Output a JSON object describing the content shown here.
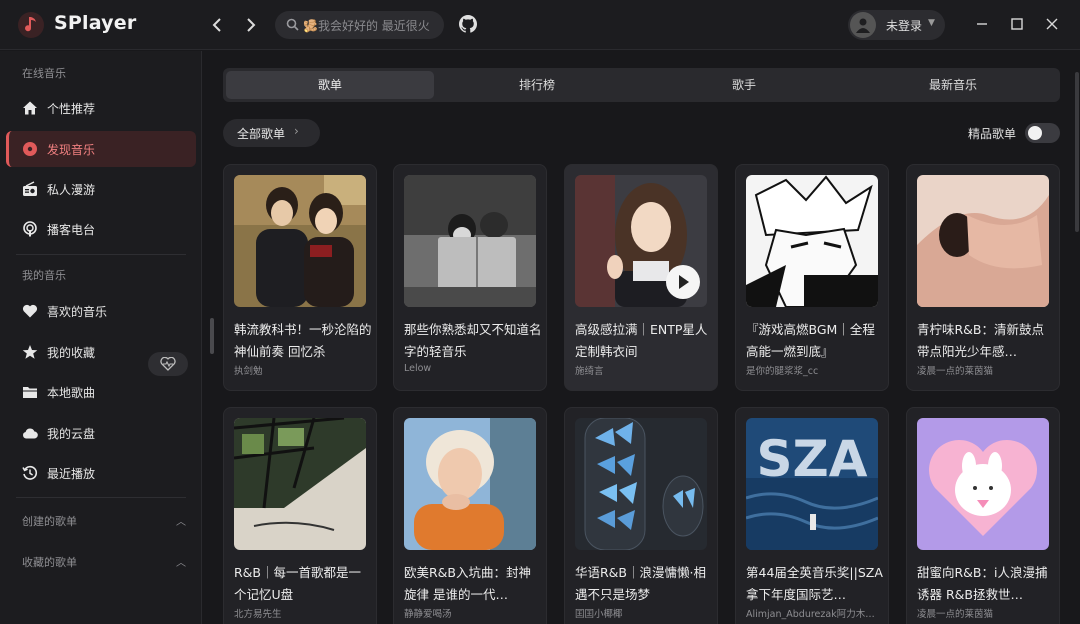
{
  "app": {
    "title": "SPlayer",
    "accent": "#e05a5a"
  },
  "search": {
    "placeholder": "🫚我会好好的 最近很火"
  },
  "user": {
    "name": "未登录"
  },
  "sidebar": {
    "section_online": "在线音乐",
    "section_mine": "我的音乐",
    "items_online": [
      {
        "label": "个性推荐",
        "icon": "home-icon"
      },
      {
        "label": "发现音乐",
        "icon": "disc-icon",
        "active": true
      },
      {
        "label": "私人漫游",
        "icon": "radio-icon"
      },
      {
        "label": "播客电台",
        "icon": "podcast-icon"
      }
    ],
    "items_mine": [
      {
        "label": "喜欢的音乐",
        "icon": "heart-icon"
      },
      {
        "label": "我的收藏",
        "icon": "star-icon"
      },
      {
        "label": "本地歌曲",
        "icon": "folder-icon"
      },
      {
        "label": "我的云盘",
        "icon": "cloud-icon"
      },
      {
        "label": "最近播放",
        "icon": "history-icon"
      }
    ],
    "created_playlists": "创建的歌单",
    "collected_playlists": "收藏的歌单"
  },
  "tabs": [
    {
      "label": "歌单",
      "active": true
    },
    {
      "label": "排行榜"
    },
    {
      "label": "歌手"
    },
    {
      "label": "最新音乐"
    }
  ],
  "filter": {
    "label": "全部歌单"
  },
  "quality": {
    "label": "精品歌单",
    "enabled": false
  },
  "playlists": [
    {
      "title": "韩流教科书！一秒沦陷的神仙前奏 回忆杀",
      "author": "执剑勉",
      "cover": "warm"
    },
    {
      "title": "那些你熟悉却又不知道名字的轻音乐",
      "author": "Lelow",
      "cover": "gray"
    },
    {
      "title": "高级感拉满｜ENTP星人定制韩衣间",
      "author": "施绮言",
      "cover": "portrait"
    },
    {
      "title": "『游戏高燃BGM｜全程高能一燃到底』",
      "author": "是你的腿浆浆_cc",
      "cover": "sketch"
    },
    {
      "title": "青柠味R&B：清新鼓点 带点阳光少年感…",
      "author": "凌晨一点的莱茵猫",
      "cover": "skin"
    },
    {
      "title": "R&B｜每一首歌都是一个记忆U盘",
      "author": "北方易先生",
      "cover": "window"
    },
    {
      "title": "欧美R&B入坑曲：封神旋律 是谁的一代…",
      "author": "静静爱喝汤",
      "cover": "blonde"
    },
    {
      "title": "华语R&B｜浪漫慵懒·相遇不只是场梦",
      "author": "囯囯小椰椰",
      "cover": "butterfly"
    },
    {
      "title": "第44届全英音乐奖||SZA拿下年度国际艺…",
      "author": "Alimjan_Abdurezak阿力木…",
      "cover": "ocean"
    },
    {
      "title": "甜蜜向R&B：i人浪漫捕诱器 R&B拯救世…",
      "author": "凌晨一点的莱茵猫",
      "cover": "pink"
    }
  ],
  "ocean_cover_text": "SZA"
}
